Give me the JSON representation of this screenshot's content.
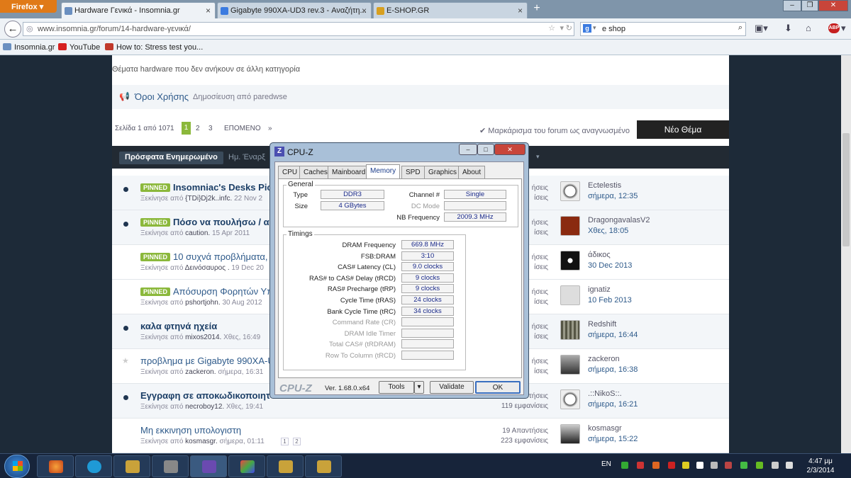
{
  "browser": {
    "menu_label": "Firefox",
    "tabs": [
      {
        "label": "Hardware Γενικά - Insomnia.gr"
      },
      {
        "label": "Gigabyte 990XA-UD3 rev.3 - Αναζήτη..."
      },
      {
        "label": "E-SHOP.GR"
      }
    ],
    "new_tab": "+",
    "url": "www.insomnia.gr/forum/14-hardware-γενικά/",
    "search_value": "e shop",
    "bookmarks": [
      {
        "label": "Insomnia.gr"
      },
      {
        "label": "YouTube"
      },
      {
        "label": "How to: Stress test you..."
      }
    ]
  },
  "forum": {
    "description": "Θέματα hardware που δεν ανήκουν σε άλλη κατηγορία",
    "terms_title": "Όροι Χρήσης",
    "terms_by": "Δημοσίευση από paredwse",
    "pager": {
      "label": "Σελίδα 1 από 1071",
      "pages": [
        "1",
        "2",
        "3"
      ],
      "next": "ΕΠΟΜΕΝΟ",
      "last": "»"
    },
    "mark_read": "Μαρκάρισμα του forum ως αναγνωσμένο",
    "new_topic": "Νέο Θέμα",
    "tab_active": "Πρόσφατα Ενημερωμένο",
    "tab_other": "Ημ. Έναρξ"
  },
  "topics": [
    {
      "pinned": "PINNED",
      "title": "Insomniac's Desks Pic",
      "sub": "Ξεκίνησε από",
      "author": "{TDi}Dj2k..infc.",
      "date": "22 Nov 2",
      "stat": "ήσεις",
      "stat2": "ίσεις",
      "user": "Ectelestis",
      "time": "σήμερα, 12:35"
    },
    {
      "pinned": "PINNED",
      "title": "Πόσο να πουλήσω / α",
      "sub": "Ξεκίνησε από",
      "author": "caution.",
      "date": "15 Apr 2011",
      "stat": "ήσεις",
      "stat2": "ίσεις",
      "user": "DragongavalasV2",
      "time": "Χθες, 18:05"
    },
    {
      "pinned": "PINNED",
      "title": "10 συχνά προβλήματα, 1",
      "sub": "Ξεκίνησε από",
      "author": "Δεινόσαυρος .",
      "date": "19 Dec 20",
      "stat": "ήσεις",
      "stat2": "ίσεις",
      "user": "άδικος",
      "time": "30 Dec 2013"
    },
    {
      "pinned": "PINNED",
      "title": "Απόσυρση Φορητών Υπ",
      "sub": "Ξεκίνησε από",
      "author": "pshortjohn.",
      "date": "30 Aug 2012",
      "stat": "ήσεις",
      "stat2": "ίσεις",
      "user": "ignatiz",
      "time": "10 Feb 2013"
    },
    {
      "title": "καλα φτηνά ηχεία",
      "sub": "Ξεκίνησε από",
      "author": "mixos2014.",
      "date": "Χθες, 16:49",
      "stat": "ήσεις",
      "stat2": "ίσεις",
      "user": "Redshift",
      "time": "σήμερα, 16:44"
    },
    {
      "title": "προβλημα με Gigabyte 990XA-U",
      "sub": "Ξεκίνησε από",
      "author": "zackeron.",
      "date": "σήμερα, 16:31",
      "stat": "ήσεις",
      "stat2": "ίσεις",
      "user": "zackeron",
      "time": "σήμερα, 16:38"
    },
    {
      "title": "Εγγραφη σε αποκωδικοποιητ",
      "sub": "Ξεκίνησε από",
      "author": "necroboy12.",
      "date": "Χθες, 19:41",
      "stat": "Απαντήσεις",
      "stat2": "119 εμφανίσεις",
      "user": ".::NikoS::.",
      "time": "σήμερα, 16:21"
    },
    {
      "title": "Μη εκκινηση υπολογιστη",
      "sub": "Ξεκίνησε από",
      "author": "kosmasgr.",
      "date": "σήμερα, 01:11",
      "stat": "19 Απαντήσεις",
      "stat2": "223 εμφανίσεις",
      "user": "kosmasgr",
      "time": "σήμερα, 15:22",
      "pages": [
        "1",
        "2"
      ]
    }
  ],
  "cpuz": {
    "title": "CPU-Z",
    "tabs": [
      "CPU",
      "Caches",
      "Mainboard",
      "Memory",
      "SPD",
      "Graphics",
      "About"
    ],
    "general_label": "General",
    "type_label": "Type",
    "type": "DDR3",
    "size_label": "Size",
    "size": "4 GBytes",
    "channel_label": "Channel #",
    "channel": "Single",
    "dc_label": "DC Mode",
    "dc": "",
    "nb_label": "NB Frequency",
    "nb": "2009.3 MHz",
    "timings_label": "Timings",
    "timings": [
      {
        "label": "DRAM Frequency",
        "value": "669.8 MHz"
      },
      {
        "label": "FSB:DRAM",
        "value": "3:10"
      },
      {
        "label": "CAS# Latency (CL)",
        "value": "9.0 clocks"
      },
      {
        "label": "RAS# to CAS# Delay (tRCD)",
        "value": "9 clocks"
      },
      {
        "label": "RAS# Precharge (tRP)",
        "value": "9 clocks"
      },
      {
        "label": "Cycle Time (tRAS)",
        "value": "24 clocks"
      },
      {
        "label": "Bank Cycle Time (tRC)",
        "value": "34 clocks"
      },
      {
        "label": "Command Rate (CR)",
        "value": ""
      },
      {
        "label": "DRAM Idle Timer",
        "value": ""
      },
      {
        "label": "Total CAS# (tRDRAM)",
        "value": ""
      },
      {
        "label": "Row To Column (tRCD)",
        "value": ""
      }
    ],
    "brand": "CPU-Z",
    "version": "Ver. 1.68.0.x64",
    "tools": "Tools",
    "validate": "Validate",
    "ok": "OK"
  },
  "taskbar": {
    "lang": "EN",
    "time": "4:47 μμ",
    "date": "2/3/2014"
  }
}
